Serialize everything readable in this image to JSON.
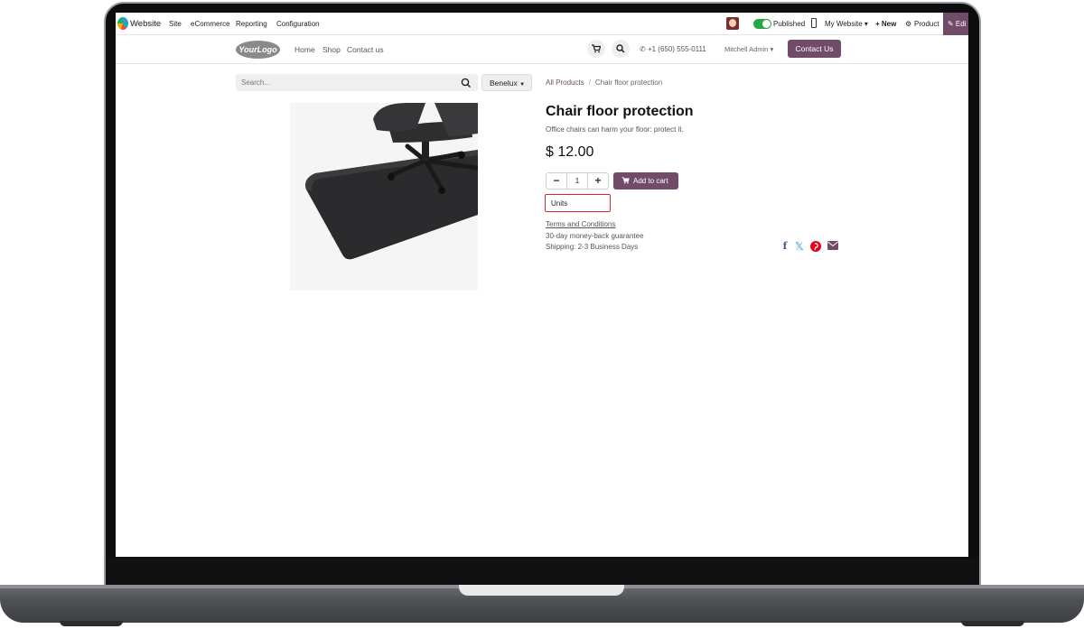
{
  "admin_bar": {
    "app_name": "Website",
    "menus": [
      "Site",
      "eCommerce",
      "Reporting",
      "Configuration"
    ],
    "published_label": "Published",
    "my_website_label": "My Website ▾",
    "new_label": "+ New",
    "product_label": "Product",
    "edit_label": "✎ Edi"
  },
  "site_header": {
    "logo_text": "YourLogo",
    "nav": [
      "Home",
      "Shop",
      "Contact us"
    ],
    "phone": "+1 (650) 555-0111",
    "user": "Mitchell Admin",
    "contact_button": "Contact Us"
  },
  "search": {
    "placeholder": "Search...",
    "pricelist": "Benelux"
  },
  "breadcrumb": {
    "parent": "All Products",
    "current": "Chair floor protection"
  },
  "product": {
    "name": "Chair floor protection",
    "description": "Office chairs can harm your floor: protect it.",
    "price": "$ 12.00",
    "quantity": "1",
    "minus": "−",
    "plus": "+",
    "add_to_cart": "Add to cart",
    "uom": "Units",
    "terms": "Terms and Conditions",
    "guarantee": "30-day money-back guarantee",
    "shipping": "Shipping: 2-3 Business Days"
  },
  "share": {
    "facebook": "f",
    "twitter": "𝕏"
  },
  "colors": {
    "brand": "#714b67",
    "published_toggle": "#28a745",
    "highlight": "#d9262d"
  }
}
